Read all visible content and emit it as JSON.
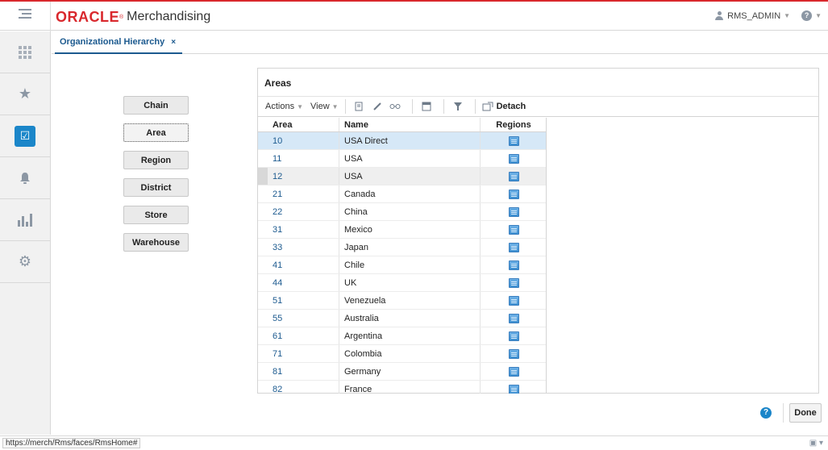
{
  "header": {
    "logo_brand": "ORACLE",
    "logo_reg": "®",
    "product": "Merchandising",
    "user": "RMS_ADMIN",
    "help_glyph": "?"
  },
  "rail": {
    "items": [
      {
        "icon": "grid-icon"
      },
      {
        "icon": "star-icon"
      },
      {
        "icon": "tasks-icon",
        "active": true
      },
      {
        "icon": "bell-icon"
      },
      {
        "icon": "reports-icon"
      },
      {
        "icon": "gear-icon"
      }
    ]
  },
  "tab": {
    "label": "Organizational Hierarchy",
    "close": "×"
  },
  "hierarchy": {
    "chain": "Chain",
    "area": "Area",
    "region": "Region",
    "district": "District",
    "store": "Store",
    "warehouse": "Warehouse"
  },
  "panel": {
    "title": "Areas",
    "actions": "Actions",
    "view": "View",
    "detach": "Detach",
    "columns": {
      "area": "Area",
      "name": "Name",
      "regions": "Regions"
    },
    "rows": [
      {
        "area": "10",
        "name": "USA Direct"
      },
      {
        "area": "11",
        "name": "USA"
      },
      {
        "area": "12",
        "name": "USA"
      },
      {
        "area": "21",
        "name": "Canada"
      },
      {
        "area": "22",
        "name": "China"
      },
      {
        "area": "31",
        "name": "Mexico"
      },
      {
        "area": "33",
        "name": "Japan"
      },
      {
        "area": "41",
        "name": "Chile"
      },
      {
        "area": "44",
        "name": "UK"
      },
      {
        "area": "51",
        "name": "Venezuela"
      },
      {
        "area": "55",
        "name": "Australia"
      },
      {
        "area": "61",
        "name": "Argentina"
      },
      {
        "area": "71",
        "name": "Colombia"
      },
      {
        "area": "81",
        "name": "Germany"
      },
      {
        "area": "82",
        "name": "France"
      }
    ]
  },
  "footer": {
    "help": "?",
    "done": "Done",
    "status_url": "https://merch/Rms/faces/RmsHome#"
  },
  "colors": {
    "brand_red": "#d9282d",
    "accent_blue": "#1b86c9",
    "link_blue": "#1c5a8f",
    "selected_row": "#d6e8f7"
  }
}
